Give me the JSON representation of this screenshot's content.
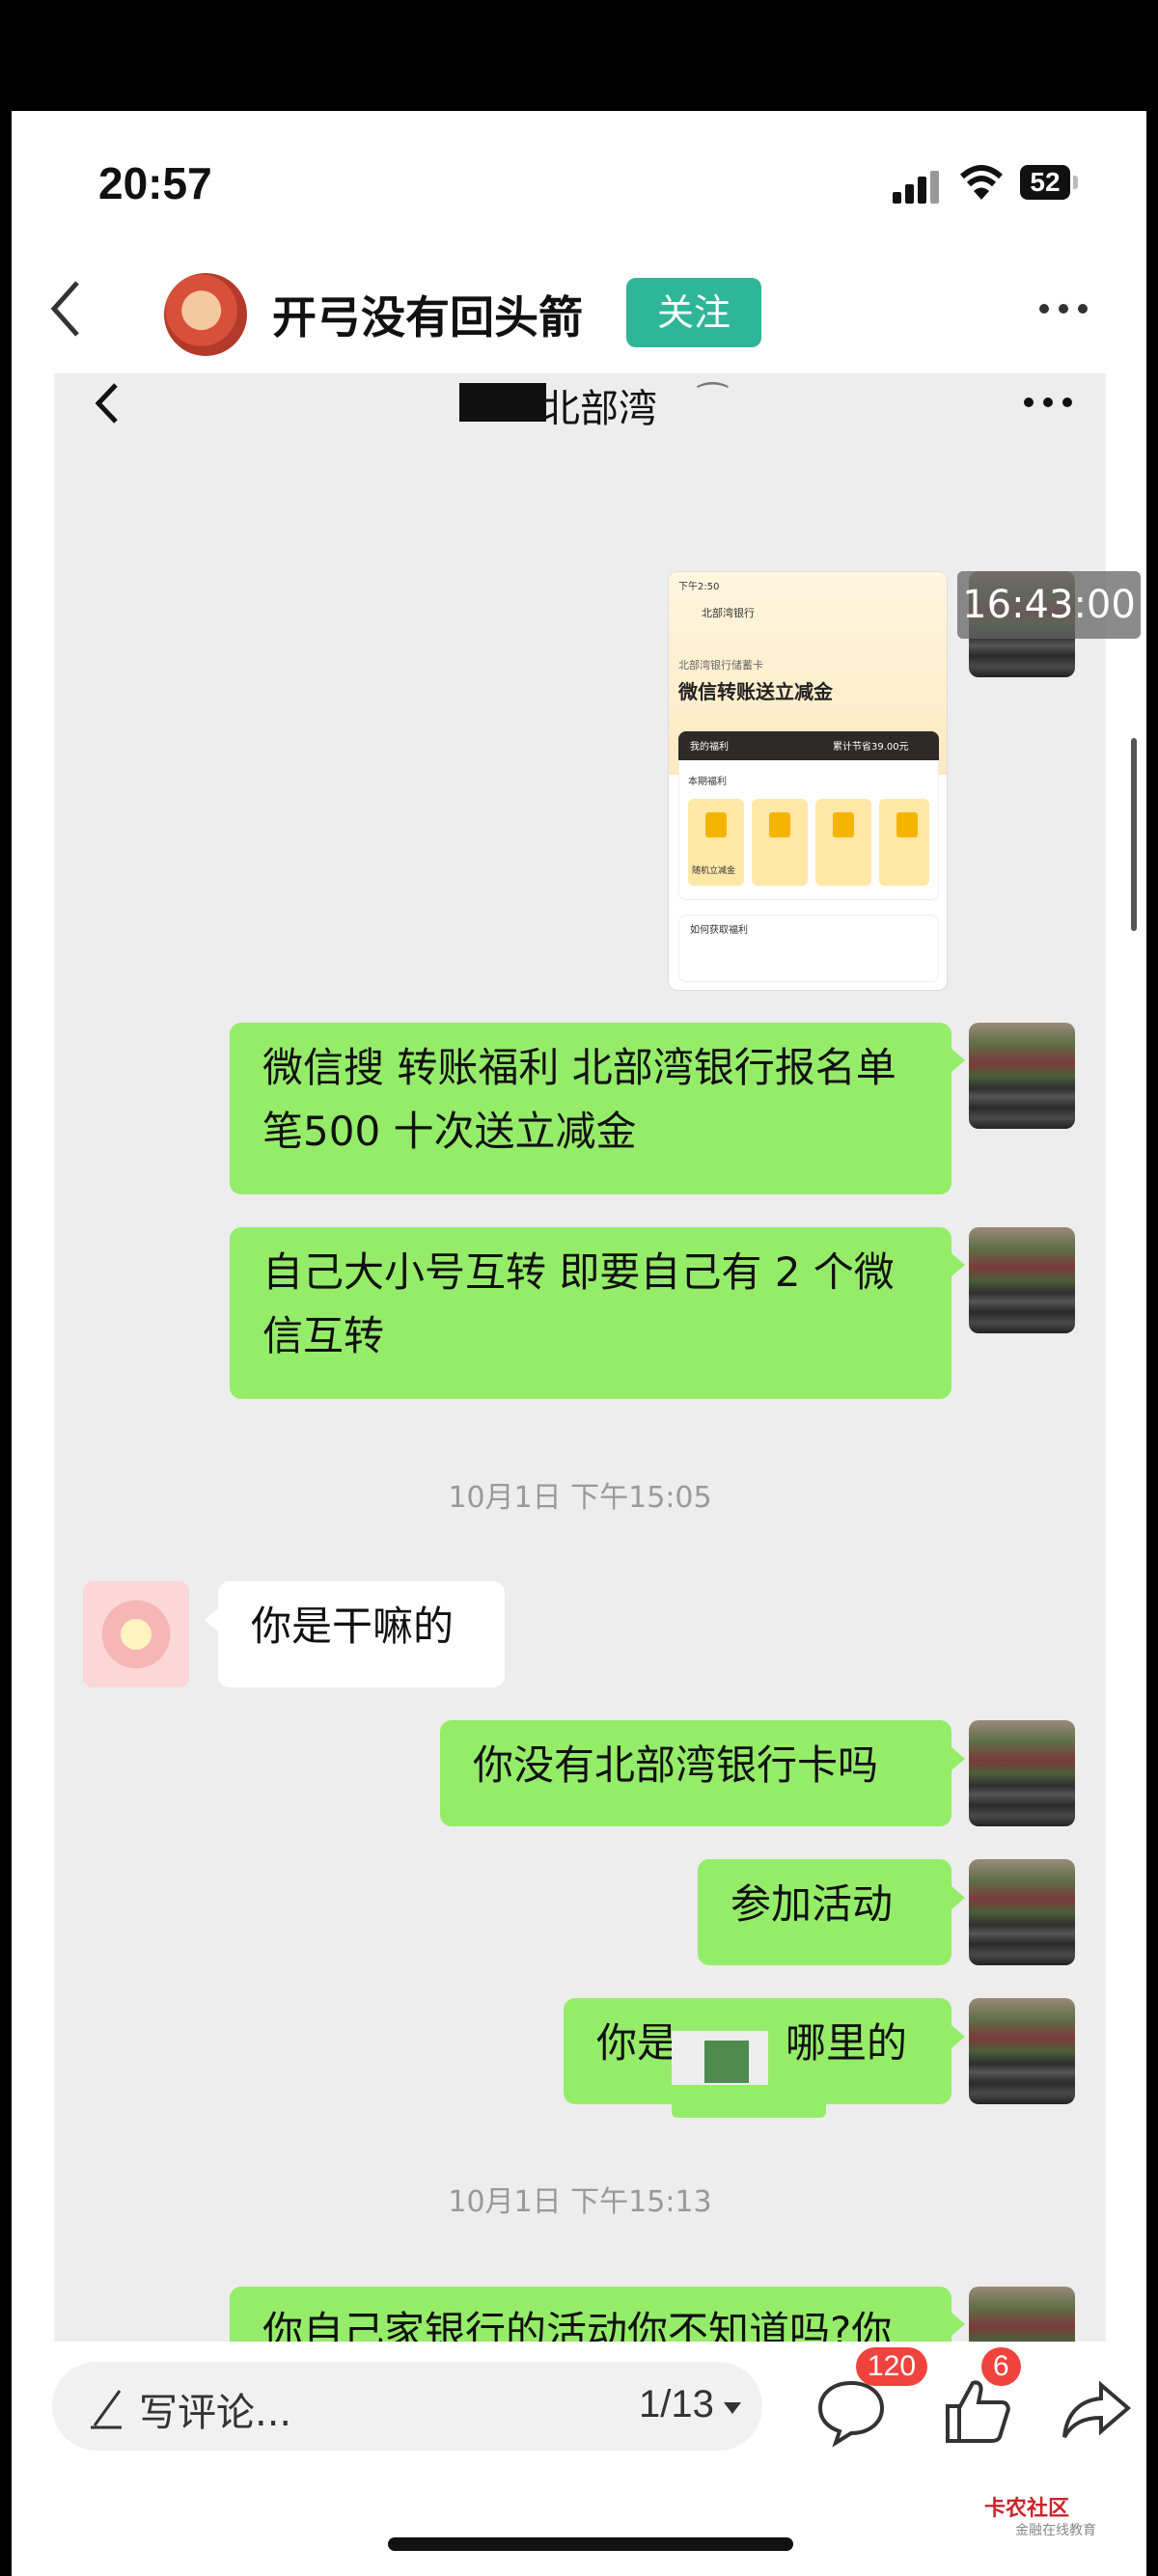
{
  "status_bar": {
    "time": "20:57",
    "battery": "52"
  },
  "post_header": {
    "author": "开弓没有回头箭",
    "follow_label": "关注"
  },
  "chat": {
    "title_visible": "北部湾",
    "image_time_badge": "16:43:00",
    "mini_screenshot": {
      "status_time": "下午2:50",
      "bank_name": "北部湾银行",
      "card_label": "北部湾银行储蓄卡",
      "headline": "微信转账送立减金",
      "benefits_label": "我的福利",
      "saved": "累计节省39.00元",
      "period_label": "本期福利",
      "coupon_text": "随机立减金",
      "how_to": "如何获取福利"
    },
    "messages": [
      {
        "side": "me",
        "text": "微信搜 转账福利 北部湾银行报名单笔500 十次送立减金"
      },
      {
        "side": "me",
        "text": "自己大小号互转 即要自己有 2 个微信互转"
      },
      {
        "type": "time",
        "text": "10月1日 下午15:05"
      },
      {
        "side": "them",
        "text": "你是干嘛的"
      },
      {
        "side": "me",
        "text": "你没有北部湾银行卡吗"
      },
      {
        "side": "me",
        "text": "参加活动"
      },
      {
        "side": "me",
        "text_left": "你是",
        "text_right": "哪里的"
      },
      {
        "type": "time",
        "text": "10月1日 下午15:13"
      },
      {
        "side": "me",
        "text": "你自己家银行的活动你不知道吗?你不参加吗?"
      }
    ]
  },
  "bottom_bar": {
    "comment_placeholder": "写评论...",
    "page_indicator": "1/13",
    "comment_count": "120",
    "like_count": "6"
  },
  "watermark": {
    "title": "卡农社区",
    "subtitle": "金融在线教育"
  },
  "colors": {
    "accent": "#2fb597",
    "bubble_me": "#95ec69",
    "badge": "#f0433e"
  }
}
